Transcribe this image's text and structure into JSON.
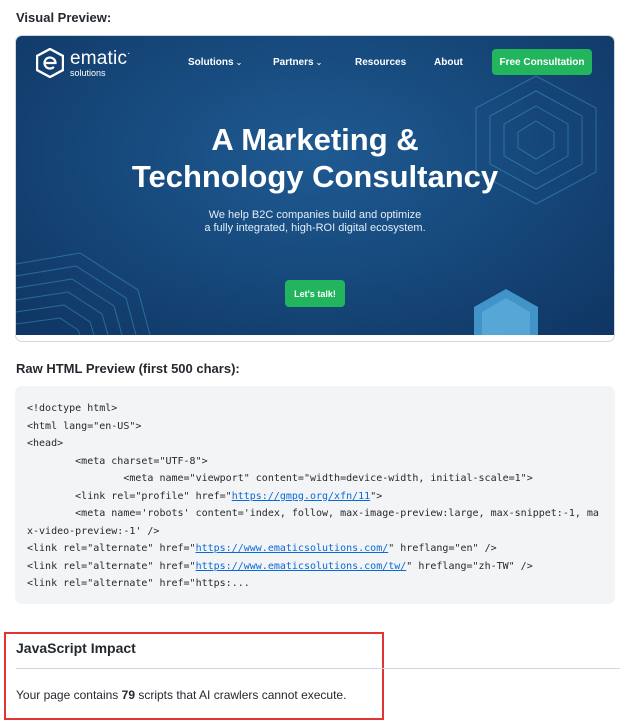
{
  "visual_preview": {
    "label": "Visual Preview:",
    "site": {
      "logo_word": "ematic",
      "logo_tm": "·",
      "logo_sub": "solutions",
      "nav": [
        {
          "label": "Solutions",
          "has_dropdown": true
        },
        {
          "label": "Partners",
          "has_dropdown": true
        },
        {
          "label": "Resources",
          "has_dropdown": false
        },
        {
          "label": "About",
          "has_dropdown": false
        }
      ],
      "cta_label": "Free Consultation",
      "hero_title_line1": "A Marketing &",
      "hero_title_line2": "Technology Consultancy",
      "hero_sub_line1": "We help B2C companies build and optimize",
      "hero_sub_line2": "a fully integrated, high-ROI digital ecosystem.",
      "talk_label": "Let's talk!",
      "colors": {
        "hero_bg": "#174a7d",
        "accent_green": "#22b55e",
        "deco_line": "#4aa3d8"
      }
    }
  },
  "raw_html": {
    "label": "Raw HTML Preview (first 500 chars):",
    "lines": [
      {
        "parts": [
          {
            "t": "<!doctype html>"
          }
        ]
      },
      {
        "parts": [
          {
            "t": "<html lang=\"en-US\">"
          }
        ]
      },
      {
        "parts": [
          {
            "t": "<head>"
          }
        ]
      },
      {
        "parts": [
          {
            "t": "        <meta charset=\"UTF-8\">"
          }
        ]
      },
      {
        "parts": [
          {
            "t": "                <meta name=\"viewport\" content=\"width=device-width, initial-scale=1\">"
          }
        ]
      },
      {
        "parts": [
          {
            "t": "        <link rel=\"profile\" href=\""
          },
          {
            "t": "https://gmpg.org/xfn/11",
            "link": true
          },
          {
            "t": "\">"
          }
        ]
      },
      {
        "parts": [
          {
            "t": "        <meta name='robots' content='index, follow, max-image-preview:large, max-snippet:-1, ma"
          }
        ]
      },
      {
        "parts": [
          {
            "t": "x-video-preview:-1' />"
          }
        ]
      },
      {
        "parts": [
          {
            "t": "<link rel=\"alternate\" href=\""
          },
          {
            "t": "https://www.ematicsolutions.com/",
            "link": true
          },
          {
            "t": "\" hreflang=\"en\" />"
          }
        ]
      },
      {
        "parts": [
          {
            "t": "<link rel=\"alternate\" href=\""
          },
          {
            "t": "https://www.ematicsolutions.com/tw/",
            "link": true
          },
          {
            "t": "\" hreflang=\"zh-TW\" />"
          }
        ]
      },
      {
        "parts": [
          {
            "t": "<link rel=\"alternate\" href=\"https:..."
          }
        ]
      }
    ]
  },
  "js_impact": {
    "title": "JavaScript Impact",
    "text_before": "Your page contains ",
    "script_count": "79",
    "text_after": " scripts that AI crawlers cannot execute.",
    "highlight_color": "#e23434"
  }
}
